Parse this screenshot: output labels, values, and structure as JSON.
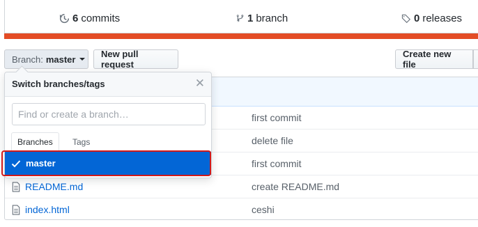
{
  "stats": {
    "commits_count": "6",
    "commits_label": "commits",
    "branch_count": "1",
    "branch_label": "branch",
    "releases_count": "0",
    "releases_label": "releases"
  },
  "colors": {
    "language_bar": "#e34c26",
    "selected": "#0366d6",
    "highlight": "#d21a1a"
  },
  "toolbar": {
    "branch_prefix": "Branch:",
    "branch_name": "master",
    "new_pull_request": "New pull request",
    "create_new_file": "Create new file"
  },
  "dropdown": {
    "title": "Switch branches/tags",
    "filter_placeholder": "Find or create a branch…",
    "tabs": {
      "branches": "Branches",
      "tags": "Tags"
    },
    "selected_branch": "master"
  },
  "files": [
    {
      "name": "",
      "message": "first commit"
    },
    {
      "name": "",
      "message": "delete file"
    },
    {
      "name": "",
      "message": "first commit"
    },
    {
      "name": "README.md",
      "message": "create README.md"
    },
    {
      "name": "index.html",
      "message": "ceshi"
    }
  ]
}
